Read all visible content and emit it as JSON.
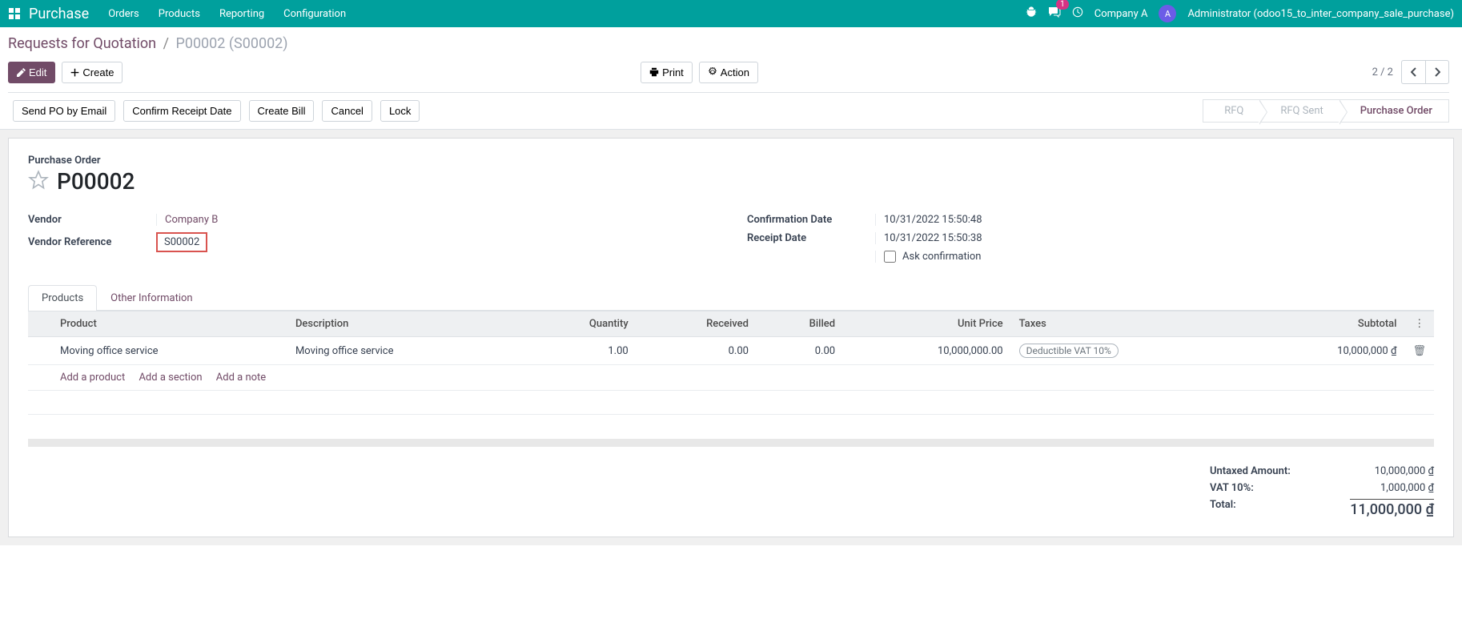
{
  "nav": {
    "brand": "Purchase",
    "menu": [
      "Orders",
      "Products",
      "Reporting",
      "Configuration"
    ],
    "messages_badge": "1",
    "company": "Company A",
    "avatar_letter": "A",
    "user": "Administrator (odoo15_to_inter_company_sale_purchase)"
  },
  "breadcrumb": {
    "link": "Requests for Quotation",
    "current": "P00002 (S00002)"
  },
  "buttons": {
    "edit": "Edit",
    "create": "Create",
    "print": "Print",
    "action": "Action"
  },
  "pager": {
    "text": "2 / 2"
  },
  "statusbar": {
    "buttons": [
      "Send PO by Email",
      "Confirm Receipt Date",
      "Create Bill",
      "Cancel",
      "Lock"
    ],
    "steps": [
      "RFQ",
      "RFQ Sent",
      "Purchase Order"
    ],
    "active_step": 2
  },
  "form": {
    "title_label": "Purchase Order",
    "title": "P00002",
    "vendor_label": "Vendor",
    "vendor": "Company B",
    "vendor_ref_label": "Vendor Reference",
    "vendor_ref": "S00002",
    "confirmation_date_label": "Confirmation Date",
    "confirmation_date": "10/31/2022 15:50:48",
    "receipt_date_label": "Receipt Date",
    "receipt_date": "10/31/2022 15:50:38",
    "ask_confirmation_label": "Ask confirmation"
  },
  "tabs": [
    "Products",
    "Other Information"
  ],
  "table": {
    "headers": {
      "product": "Product",
      "description": "Description",
      "quantity": "Quantity",
      "received": "Received",
      "billed": "Billed",
      "unit_price": "Unit Price",
      "taxes": "Taxes",
      "subtotal": "Subtotal"
    },
    "rows": [
      {
        "product": "Moving office service",
        "description": "Moving office service",
        "quantity": "1.00",
        "received": "0.00",
        "billed": "0.00",
        "unit_price": "10,000,000.00",
        "tax": "Deductible VAT 10%",
        "subtotal": "10,000,000 ₫"
      }
    ],
    "add_product": "Add a product",
    "add_section": "Add a section",
    "add_note": "Add a note"
  },
  "totals": {
    "untaxed_label": "Untaxed Amount:",
    "untaxed": "10,000,000 ₫",
    "vat_label": "VAT 10%:",
    "vat": "1,000,000 ₫",
    "total_label": "Total:",
    "total": "11,000,000 ₫"
  }
}
